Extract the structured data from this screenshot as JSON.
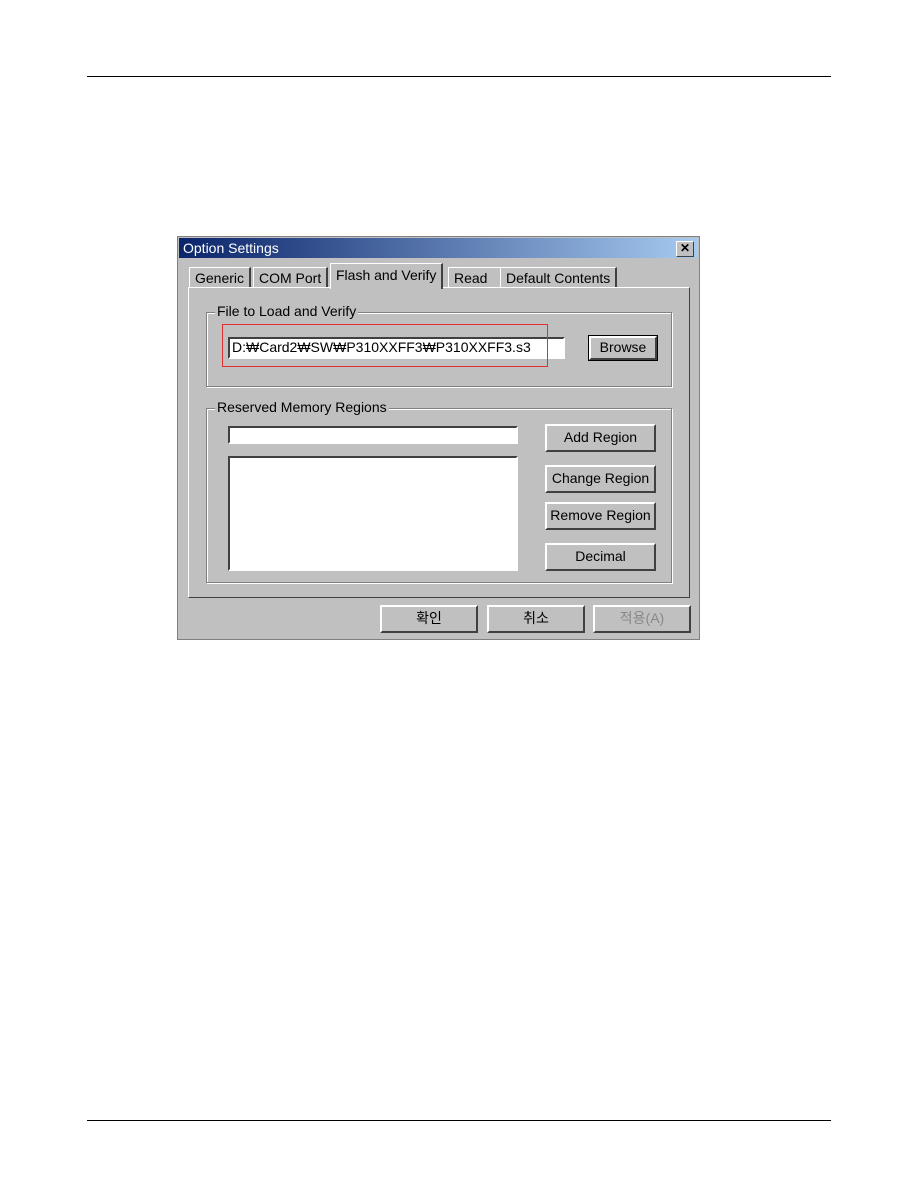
{
  "dialog": {
    "title": "Option Settings",
    "tabs": [
      "Generic",
      "COM Port",
      "Flash and Verify",
      "Read",
      "Default Contents"
    ],
    "active_tab": "Flash and Verify",
    "file_group": {
      "label": "File to Load and Verify",
      "path": "D:₩Card2₩SW₩P310XXFF3₩P310XXFF3.s3",
      "browse": "Browse"
    },
    "regions_group": {
      "label": "Reserved Memory Regions",
      "input_value": "",
      "list_items": [],
      "add": "Add Region",
      "change": "Change Region",
      "remove": "Remove Region",
      "decimal": "Decimal"
    },
    "footer": {
      "ok": "확인",
      "cancel": "취소",
      "apply": "적용(A)"
    },
    "highlight_color": "#e03030"
  }
}
